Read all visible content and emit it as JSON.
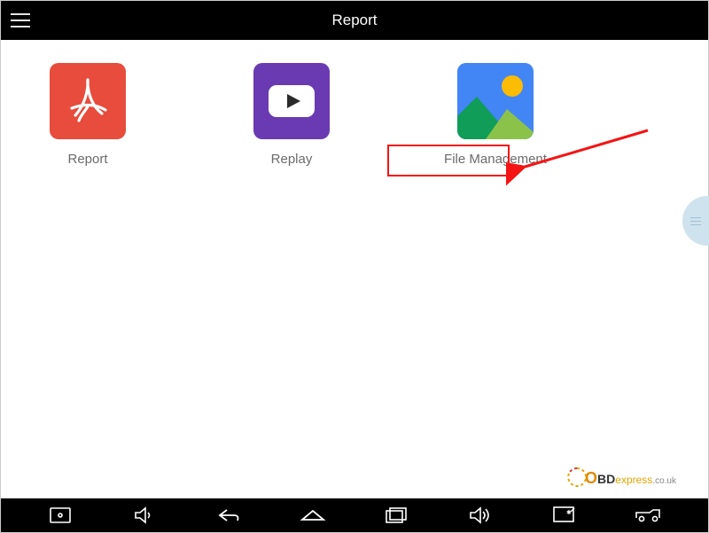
{
  "header": {
    "title": "Report"
  },
  "tiles": [
    {
      "label": "Report",
      "icon": "adobe-pdf-icon",
      "bg": "#e74c3c"
    },
    {
      "label": "Replay",
      "icon": "youtube-icon",
      "bg": "#6a3ab2"
    },
    {
      "label": "File Management",
      "icon": "gallery-icon",
      "bg": "#4285f4"
    }
  ],
  "annotation": {
    "highlight_target": "File Management",
    "arrow_color": "#f41414"
  },
  "watermark": {
    "brand_a": "O",
    "brand_b": "BD",
    "brand_c": "express",
    "tld": ".co.uk"
  },
  "nav": {
    "items": [
      "screenshot",
      "volume-down",
      "back",
      "home",
      "recent",
      "volume-up",
      "cast",
      "vehicle"
    ]
  },
  "colors": {
    "highlight": "#f41414",
    "header_bg": "#000000"
  }
}
